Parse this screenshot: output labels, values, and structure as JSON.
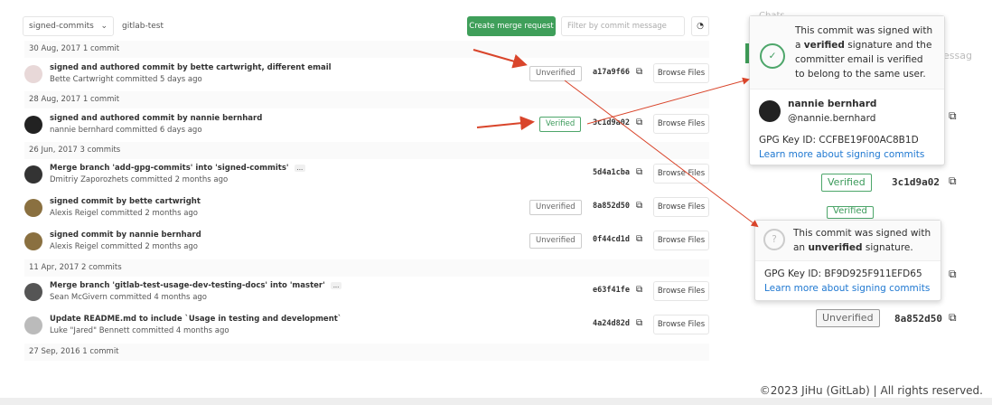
{
  "toolbar": {
    "branch": "signed-commits",
    "project": "gitlab-test",
    "create_mr": "Create merge request",
    "filter_placeholder": "Filter by commit message"
  },
  "groups": [
    {
      "date": "30 Aug, 2017 1 commit",
      "commits": [
        {
          "title": "signed and authored commit by bette cartwright, different email",
          "meta": "Bette Cartwright committed 5 days ago",
          "badge": "Unverified",
          "sha": "a17a9f66"
        }
      ]
    },
    {
      "date": "28 Aug, 2017 1 commit",
      "commits": [
        {
          "title": "signed and authored commit by nannie bernhard",
          "meta": "nannie bernhard committed 6 days ago",
          "badge": "Verified",
          "sha": "3c1d9a02"
        }
      ]
    },
    {
      "date": "26 Jun, 2017 3 commits",
      "commits": [
        {
          "title": "Merge branch 'add-gpg-commits' into 'signed-commits'",
          "meta": "Dmitriy Zaporozhets committed 2 months ago",
          "badge": "",
          "sha": "5d4a1cba"
        },
        {
          "title": "signed commit by bette cartwright",
          "meta": "Alexis Reigel committed 2 months ago",
          "badge": "Unverified",
          "sha": "8a852d50"
        },
        {
          "title": "signed commit by nannie bernhard",
          "meta": "Alexis Reigel committed 2 months ago",
          "badge": "Unverified",
          "sha": "0f44cd1d"
        }
      ]
    },
    {
      "date": "11 Apr, 2017 2 commits",
      "commits": [
        {
          "title": "Merge branch 'gitlab-test-usage-dev-testing-docs' into 'master'",
          "meta": "Sean McGivern committed 4 months ago",
          "badge": "",
          "sha": "e63f41fe"
        },
        {
          "title": "Update README.md to include `Usage in testing and development`",
          "meta": "Luke \"Jared\" Bennett committed 4 months ago",
          "badge": "",
          "sha": "4a24d82d"
        }
      ]
    },
    {
      "date": "27 Sep, 2016 1 commit",
      "commits": []
    }
  ],
  "browse_label": "Browse Files",
  "more_label": "...",
  "popover_verified": {
    "text_pre": "This commit was signed with a ",
    "bold": "verified",
    "text_post": " signature and the committer email is verified to belong to the same user.",
    "user_name": "nannie bernhard",
    "username": "@nannie.bernhard",
    "gpg": "GPG Key ID: CCFBE19F00AC8B1D",
    "link": "Learn more about signing commits",
    "badge": "Verified",
    "sha": "3c1d9a02"
  },
  "popover_unverified": {
    "text_pre": "This commit was signed with an ",
    "bold": "unverified",
    "text_post": " signature.",
    "gpg": "GPG Key ID: BF9D925F911EFD65",
    "link": "Learn more about signing commits",
    "badge": "Unverified",
    "sha": "8a852d50"
  },
  "bg_fragments": {
    "chats": "Chats",
    "filter": "essag",
    "verified": "Verified"
  },
  "footer": "©2023 JiHu (GitLab) | All rights reserved.",
  "colors": {
    "green": "#3f9f5a",
    "link": "#1f78d1",
    "arrow": "#d9452b"
  }
}
